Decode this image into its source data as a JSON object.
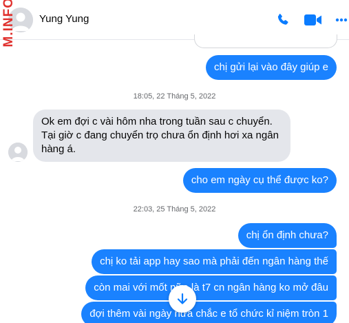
{
  "header": {
    "contact_name": "Yung Yung",
    "icons": [
      "phone-icon",
      "video-icon",
      "more-icon"
    ],
    "accent_color": "#0a7cff"
  },
  "watermark": "M.INFO",
  "messages": [
    {
      "sender": "me",
      "text": "chị gửi lại vào đây giúp e"
    },
    {
      "type": "timestamp",
      "text": "18:05, 22 Tháng 5, 2022"
    },
    {
      "sender": "contact",
      "lines": [
        "Ok em đợi c vài hôm nha trong tuần sau c chuyển.",
        "Tại giờ c đang chuyển trọ chưa ổn định hơi xa ngân",
        "hàng á."
      ]
    },
    {
      "sender": "me",
      "text": "cho em ngày cụ thể được ko?"
    },
    {
      "type": "timestamp",
      "text": "22:03, 25 Tháng 5, 2022"
    },
    {
      "sender": "me",
      "text": "chị ổn định chưa?"
    },
    {
      "sender": "me",
      "text": "chị ko tải app hay sao mà phải đến ngân hàng thế"
    },
    {
      "sender": "me",
      "text": "còn mai với mốt nữa là t7 cn ngân hàng ko mở đâu"
    },
    {
      "sender": "me",
      "text": "đợi thêm vài ngày nữa chắc e tổ chức kỉ niệm tròn 1"
    }
  ],
  "colors": {
    "outgoing_bubble": "#1a82ff",
    "incoming_bubble": "#e4e6eb",
    "timestamp_text": "#65676b",
    "watermark": "#e0312e"
  }
}
